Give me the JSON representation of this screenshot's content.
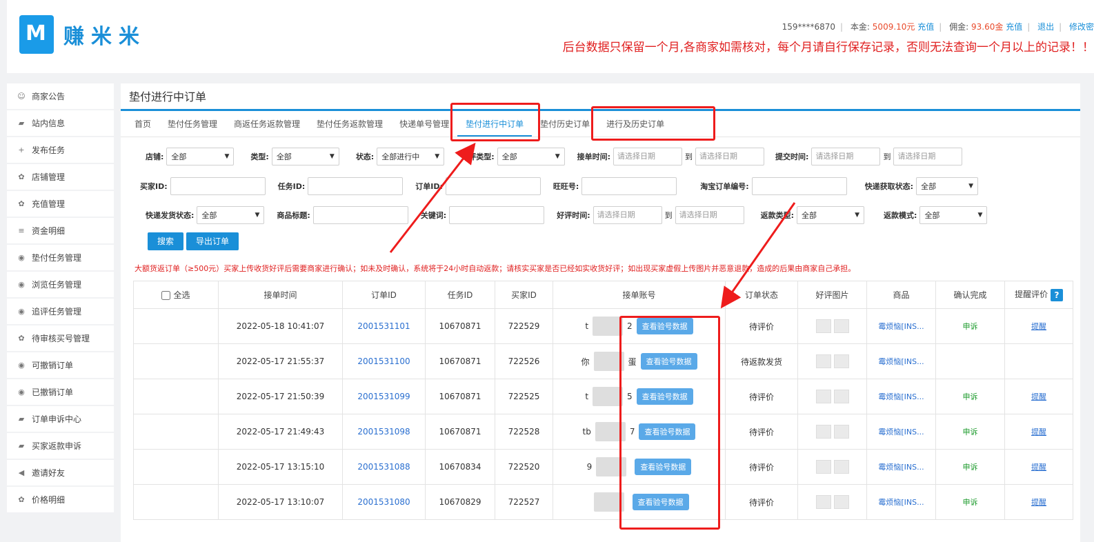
{
  "header": {
    "logo_text": "赚米米",
    "phone": "159****6870",
    "principal_label": "本金:",
    "principal_value": "5009.10元",
    "recharge1": "充值",
    "commission_label": "佣金:",
    "commission_value": "93.60金",
    "recharge2": "充值",
    "logout": "退出",
    "modify": "修改密",
    "notice": "后台数据只保留一个月,各商家如需核对，每个月请自行保存记录，否则无法查询一个月以上的记录！！"
  },
  "sidebar": {
    "items": [
      {
        "icon": "☺",
        "icon_name": "smile-icon",
        "label": "商家公告"
      },
      {
        "icon": "▰",
        "icon_name": "message-icon",
        "label": "站内信息"
      },
      {
        "icon": "+",
        "icon_name": "plus-icon",
        "label": "发布任务"
      },
      {
        "icon": "✿",
        "icon_name": "gear-icon",
        "label": "店铺管理"
      },
      {
        "icon": "✿",
        "icon_name": "gear-icon",
        "label": "充值管理"
      },
      {
        "icon": "≡",
        "icon_name": "database-icon",
        "label": "资金明细"
      },
      {
        "icon": "◉",
        "icon_name": "eye-icon",
        "label": "垫付任务管理"
      },
      {
        "icon": "◉",
        "icon_name": "eye-icon",
        "label": "浏览任务管理"
      },
      {
        "icon": "◉",
        "icon_name": "eye-icon",
        "label": "追评任务管理"
      },
      {
        "icon": "✿",
        "icon_name": "gear-icon",
        "label": "待审核买号管理"
      },
      {
        "icon": "◉",
        "icon_name": "eye-icon",
        "label": "可撤销订单"
      },
      {
        "icon": "◉",
        "icon_name": "eye-icon",
        "label": "已撤销订单"
      },
      {
        "icon": "▰",
        "icon_name": "message-icon",
        "label": "订单申诉中心"
      },
      {
        "icon": "▰",
        "icon_name": "message-icon",
        "label": "买家返款申诉"
      },
      {
        "icon": "◀",
        "icon_name": "megaphone-icon",
        "label": "邀请好友"
      },
      {
        "icon": "✿",
        "icon_name": "gear-icon",
        "label": "价格明细"
      }
    ]
  },
  "main": {
    "title": "垫付进行中订单",
    "tabs": [
      "首页",
      "垫付任务管理",
      "商返任务返款管理",
      "垫付任务返款管理",
      "快递单号管理",
      "垫付进行中订单",
      "垫付历史订单",
      "进行及历史订单"
    ]
  },
  "filters": {
    "shop_label": "店铺:",
    "shop_value": "全部",
    "type_label": "类型:",
    "type_value": "全部",
    "status_label": "状态:",
    "status_value": "全部进行中",
    "review_type_label": "好评类型:",
    "review_type_value": "全部",
    "accept_time_label": "接单时间:",
    "submit_time_label": "提交时间:",
    "date_placeholder": "请选择日期",
    "to": "到",
    "buyer_id_label": "买家ID:",
    "task_id_label": "任务ID:",
    "order_id_label": "订单ID:",
    "wangwang_label": "旺旺号:",
    "taobao_order_label": "淘宝订单编号:",
    "express_get_label": "快递获取状态:",
    "express_get_value": "全部",
    "express_ship_label": "快递发货状态:",
    "express_ship_value": "全部",
    "product_title_label": "商品标题:",
    "keyword_label": "关键词:",
    "review_time_label": "好评时间:",
    "refund_type_label": "返款类型:",
    "refund_type_value": "全部",
    "refund_mode_label": "返款模式:",
    "refund_mode_value": "全部",
    "search_btn": "搜索",
    "export_btn": "导出订单"
  },
  "warning": "大额货返订单（≥500元）买家上传收货好评后需要商家进行确认；如未及时确认，系统将于24小时自动返款；请核实买家是否已经如实收货好评；如出现买家虚假上传图片并恶意退款，造成的后果由商家自己承担。",
  "table": {
    "headers": {
      "select_all": "全选",
      "accept_time": "接单时间",
      "order_id": "订单ID",
      "task_id": "任务ID",
      "buyer_id": "买家ID",
      "account": "接单账号",
      "status": "订单状态",
      "review_images": "好评图片",
      "product": "商品",
      "confirm": "确认完成",
      "remind_review": "提醒评价"
    },
    "rows": [
      {
        "time": "2022-05-18 10:41:07",
        "order_id": "2001531101",
        "task_id": "10670871",
        "buyer_id": "722529",
        "acct_pre": "t",
        "acct_post": "2",
        "check": "查看验号数据",
        "status": "待评价",
        "product": "霉烦恼[INS...",
        "confirm": "申诉",
        "remind": "提醒"
      },
      {
        "time": "2022-05-17 21:55:37",
        "order_id": "2001531100",
        "task_id": "10670871",
        "buyer_id": "722526",
        "acct_pre": "你",
        "acct_post": "蛋",
        "check": "查看验号数据",
        "status": "待返款发货",
        "product": "霉烦恼[INS...",
        "confirm": "",
        "remind": ""
      },
      {
        "time": "2022-05-17 21:50:39",
        "order_id": "2001531099",
        "task_id": "10670871",
        "buyer_id": "722525",
        "acct_pre": "t",
        "acct_post": "5",
        "check": "查看验号数据",
        "status": "待评价",
        "product": "霉烦恼[INS...",
        "confirm": "申诉",
        "remind": "提醒"
      },
      {
        "time": "2022-05-17 21:49:43",
        "order_id": "2001531098",
        "task_id": "10670871",
        "buyer_id": "722528",
        "acct_pre": "tb",
        "acct_post": "7",
        "check": "查看验号数据",
        "status": "待评价",
        "product": "霉烦恼[INS...",
        "confirm": "申诉",
        "remind": "提醒"
      },
      {
        "time": "2022-05-17 13:15:10",
        "order_id": "2001531088",
        "task_id": "10670834",
        "buyer_id": "722520",
        "acct_pre": "9",
        "acct_post": "",
        "check": "查看验号数据",
        "status": "待评价",
        "product": "霉烦恼[INS...",
        "confirm": "申诉",
        "remind": "提醒"
      },
      {
        "time": "2022-05-17 13:10:07",
        "order_id": "2001531080",
        "task_id": "10670829",
        "buyer_id": "722527",
        "acct_pre": "",
        "acct_post": "",
        "check": "查看验号数据",
        "status": "待评价",
        "product": "霉烦恼[INS...",
        "confirm": "申诉",
        "remind": "提醒"
      }
    ]
  },
  "colors": {
    "accent": "#1a8fd8",
    "annotation": "#ee1c1c",
    "warning": "#e02020"
  }
}
